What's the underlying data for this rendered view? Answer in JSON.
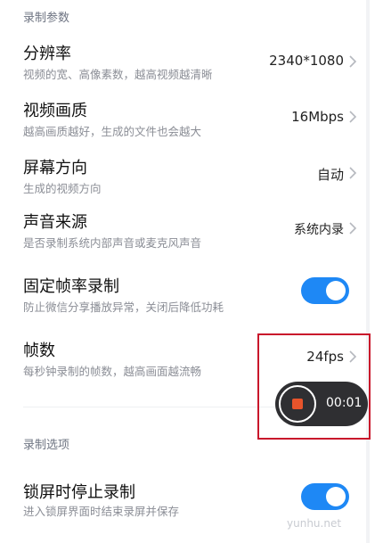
{
  "sections": {
    "recording_params": "录制参数",
    "recording_options": "录制选项"
  },
  "rows": {
    "resolution": {
      "title": "分辨率",
      "subtitle": "视频的宽、高像素数，越高视频越清晰",
      "value": "2340*1080"
    },
    "quality": {
      "title": "视频画质",
      "subtitle": "越高画质越好，生成的文件也会越大",
      "value": "16Mbps"
    },
    "orientation": {
      "title": "屏幕方向",
      "subtitle": "生成的视频方向",
      "value": "自动"
    },
    "audio_source": {
      "title": "声音来源",
      "subtitle": "是否录制系统内部声音或麦克风声音",
      "value": "系统内录"
    },
    "fixed_framerate": {
      "title": "固定帧率录制",
      "subtitle": "防止微信分享播放异常，关闭后降低功耗",
      "on": true
    },
    "framerate": {
      "title": "帧数",
      "subtitle": "每秒钟录制的帧数，越高画面越流畅",
      "value": "24fps"
    },
    "lock_stop": {
      "title": "锁屏时停止录制",
      "subtitle": "进入锁屏界面时结束录屏并保存",
      "on": true
    }
  },
  "recorder": {
    "time": "00:01"
  },
  "watermark": "yunhu.net",
  "colors": {
    "accent": "#1e88f5",
    "highlight": "#c9152b",
    "stop": "#e8542b"
  },
  "icons": {
    "chevron": "chevron-right-icon",
    "stop": "stop-icon"
  }
}
